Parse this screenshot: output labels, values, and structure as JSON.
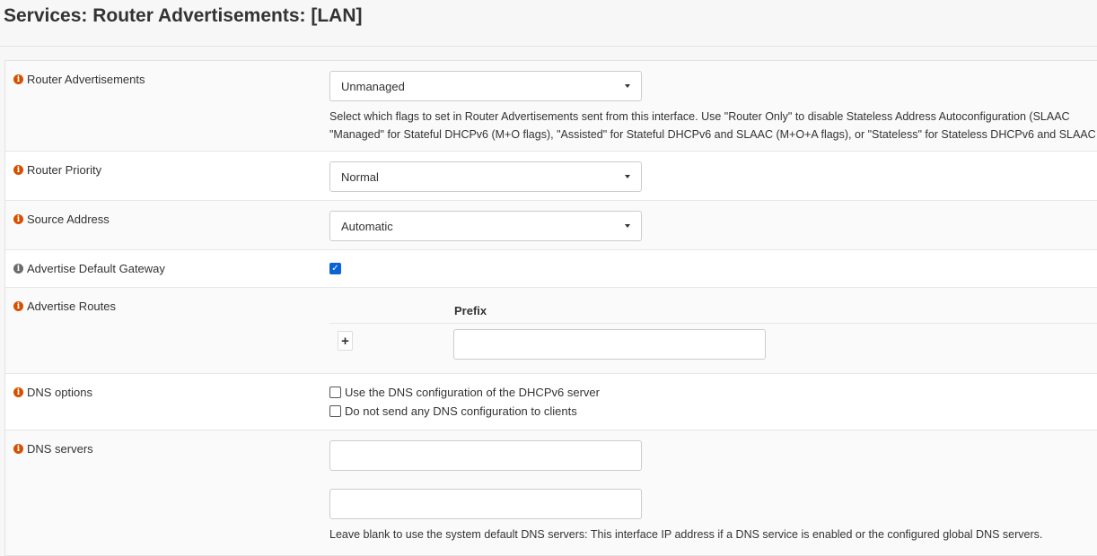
{
  "title": "Services: Router Advertisements: [LAN]",
  "rows": {
    "ra": {
      "label": "Router Advertisements",
      "value": "Unmanaged",
      "help1": "Select which flags to set in Router Advertisements sent from this interface. Use \"Router Only\" to disable Stateless Address Autoconfiguration (SLAAC",
      "help2": "\"Managed\" for Stateful DHCPv6 (M+O flags), \"Assisted\" for Stateful DHCPv6 and SLAAC (M+O+A flags), or \"Stateless\" for Stateless DHCPv6 and SLAAC"
    },
    "priority": {
      "label": "Router Priority",
      "value": "Normal"
    },
    "source": {
      "label": "Source Address",
      "value": "Automatic"
    },
    "gateway": {
      "label": "Advertise Default Gateway",
      "checked": true
    },
    "routes": {
      "label": "Advertise Routes",
      "column": "Prefix",
      "prefix_value": ""
    },
    "dns_options": {
      "label": "DNS options",
      "opt1": "Use the DNS configuration of the DHCPv6 server",
      "opt2": "Do not send any DNS configuration to clients"
    },
    "dns_servers": {
      "label": "DNS servers",
      "help": "Leave blank to use the system default DNS servers: This interface IP address if a DNS service is enabled or the configured global DNS servers."
    }
  },
  "colors": {
    "info": "#d94f00",
    "checkbox": "#0b63d6"
  }
}
